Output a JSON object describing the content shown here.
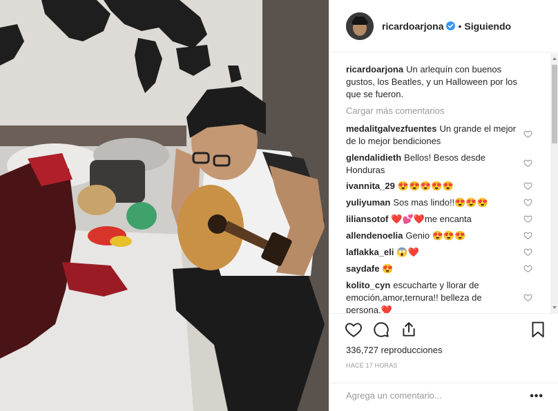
{
  "header": {
    "username": "ricardoarjona",
    "separator": "•",
    "follow_label": "Siguiendo"
  },
  "caption": {
    "username": "ricardoarjona",
    "text": "Un arlequín con buenos gustos, los Beatles, y un Halloween por los que se fueron."
  },
  "load_more_label": "Cargar más comentarios",
  "comments": [
    {
      "username": "medalitgalvezfuentes",
      "text": "Un grande el mejor de lo mejor bendiciones"
    },
    {
      "username": "glendalidieth",
      "text": "Bellos! Besos desde Honduras"
    },
    {
      "username": "ivannita_29",
      "text": "😍😍😍😍😍"
    },
    {
      "username": "yuliyuman",
      "text": "Sos mas lindo!!😍😍😍"
    },
    {
      "username": "liliansotof",
      "text": "❤️💕❤️me encanta"
    },
    {
      "username": "allendenoelia",
      "text": "Genio 😍😍😍"
    },
    {
      "username": "laflakka_eli",
      "text": "😱❤️"
    },
    {
      "username": "saydafe",
      "text": "😍"
    },
    {
      "username": "kolito_cyn",
      "text": "escucharte y llorar de emoción,amor,ternura!! belleza de persona.❤️"
    }
  ],
  "stats": {
    "views": "336,727 reproducciones",
    "time": "HACE 17 HORAS"
  },
  "add_comment": {
    "placeholder": "Agrega un comentario...",
    "more_label": "•••"
  },
  "icons": {
    "verified": "verified-badge-icon",
    "like": "heart-icon",
    "comment": "comment-bubble-icon",
    "share": "share-icon",
    "save": "bookmark-icon"
  },
  "colors": {
    "verified_blue": "#3897f0",
    "muted_text": "#999999",
    "divider": "#efefef"
  }
}
